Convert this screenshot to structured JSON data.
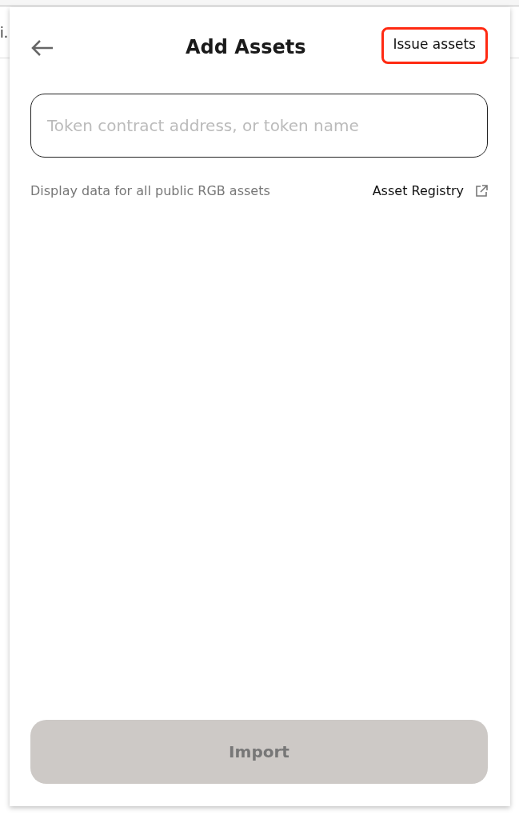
{
  "background": {
    "edge_text": "i."
  },
  "header": {
    "title": "Add Assets",
    "action": {
      "label": "Issue assets",
      "highlighted": true
    }
  },
  "search": {
    "placeholder": "Token contract address, or token name"
  },
  "info": {
    "text": "Display data for all public RGB assets",
    "link": "Asset Registry"
  },
  "import_button": {
    "label": "Import",
    "disabled": true
  }
}
